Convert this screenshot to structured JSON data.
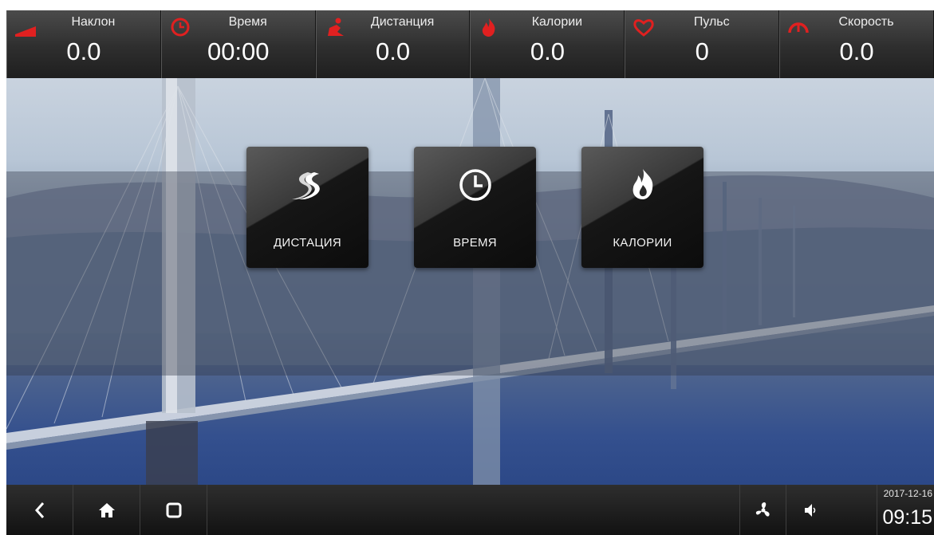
{
  "stats": [
    {
      "label": "Наклон",
      "value": "0.0",
      "icon": "incline-icon"
    },
    {
      "label": "Время",
      "value": "00:00",
      "icon": "clock-icon"
    },
    {
      "label": "Дистанция",
      "value": "0.0",
      "icon": "runner-icon"
    },
    {
      "label": "Калории",
      "value": "0.0",
      "icon": "flame-icon"
    },
    {
      "label": "Пульс",
      "value": "0",
      "icon": "heart-icon"
    },
    {
      "label": "Скорость",
      "value": "0.0",
      "icon": "speedometer-icon"
    }
  ],
  "modes": [
    {
      "label": "ДИСТАЦИЯ",
      "icon": "road-icon"
    },
    {
      "label": "ВРЕМЯ",
      "icon": "clock-icon"
    },
    {
      "label": "КАЛОРИИ",
      "icon": "flame-icon"
    }
  ],
  "navbar": {
    "buttons": [
      "back-icon",
      "home-icon",
      "recents-icon"
    ],
    "right_buttons": [
      "fan-icon",
      "volume-icon"
    ],
    "date": "2017-12-16",
    "time": "09:15"
  },
  "colors": {
    "accent": "#e02020",
    "topbar": "#2e2e2e",
    "navbar": "#1a1a1a"
  }
}
